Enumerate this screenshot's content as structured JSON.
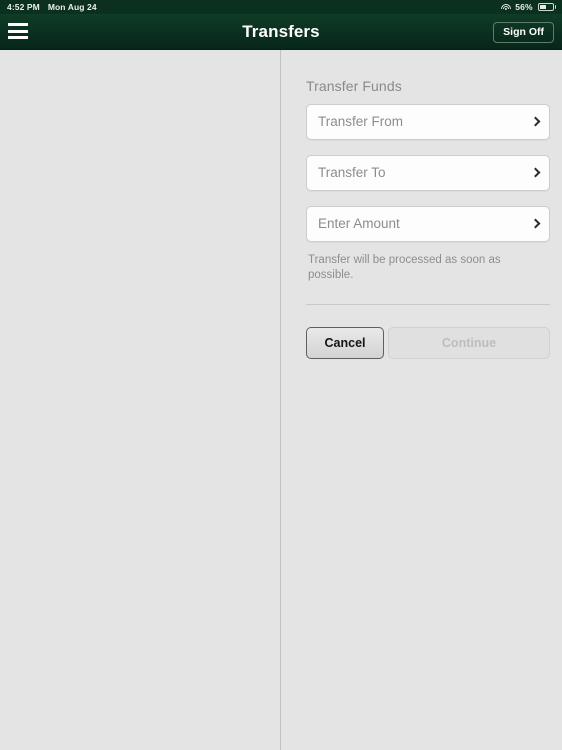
{
  "status_bar": {
    "time": "4:52 PM",
    "date": "Mon Aug 24",
    "wifi_icon": "wifi-icon",
    "battery_percent": "56%",
    "battery_level": 56
  },
  "nav_bar": {
    "menu_icon": "hamburger-menu-icon",
    "title": "Transfers",
    "sign_off_label": "Sign Off"
  },
  "transfer_form": {
    "section_title": "Transfer Funds",
    "fields": [
      {
        "label": "Transfer From",
        "value": "",
        "icon": "chevron-right-icon"
      },
      {
        "label": "Transfer To",
        "value": "",
        "icon": "chevron-right-icon"
      },
      {
        "label": "Enter Amount",
        "value": "",
        "icon": "chevron-right-icon"
      }
    ],
    "helper_text": "Transfer will be processed as soon as possible.",
    "cancel_label": "Cancel",
    "continue_label": "Continue",
    "continue_enabled": false
  },
  "colors": {
    "nav_green_top": "#0f3c26",
    "nav_green_bottom": "#07261a",
    "status_green": "#0c3020",
    "panel_gray": "#e4e4e4",
    "field_white": "#fdfdfd",
    "muted_text": "#8d8d8d",
    "disabled_text": "#bdbdbd"
  }
}
